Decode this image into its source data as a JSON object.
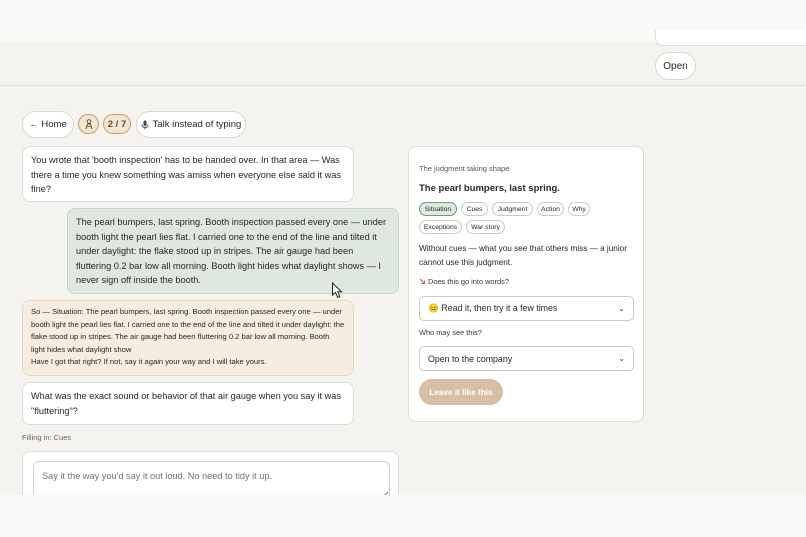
{
  "top": {
    "open_label": "Open"
  },
  "toolbar": {
    "home_label": "← Home",
    "person_badge_icon": "person-icon",
    "progress": "2 / 7",
    "talk_label": "Talk instead of typing",
    "talk_icon": "microphone-icon"
  },
  "chat": {
    "q1": "You wrote that 'booth inspection' has to be handed over. In that area — Was there a time you knew something was amiss when everyone else said it was fine?",
    "a1": "The pearl bumpers, last spring. Booth inspection passed every one — under booth light the pearl lies flat. I carried one to the end of the line and tilted it under daylight: the flake stood up in stripes. The air gauge had been fluttering 0.2 bar low all morning. Booth light hides what daylight shows — I never sign off inside the booth.",
    "summary": "So — Situation: The pearl bumpers, last spring. Booth inspection passed every one — under booth light the pearl lies flat. I carried one to the end of the line and tilted it under daylight: the flake stood up in stripes. The air gauge had been fluttering 0.2 bar low all morning. Booth light hides what daylight show",
    "summary_confirm": "Have I got that right? If not, say it again your way and I will take yours.",
    "q2": "What was the exact sound or behavior of that air gauge when you say it was \"fluttering\"?",
    "filling": "Filling in: Cues",
    "input_placeholder": "Say it the way you'd say it out loud. No need to tidy it up."
  },
  "panel": {
    "kicker": "The judgment taking shape",
    "title": "The pearl bumpers, last spring.",
    "chips": [
      "Situation",
      "Cues",
      "Judgment",
      "Action",
      "Why",
      "Exceptions",
      "War story"
    ],
    "active_chip": "Situation",
    "description": "Without cues — what you see that others miss — a junior cannot use this judgment.",
    "words_label": "Does this go into words?",
    "words_icon": "pointing-down-icon",
    "words_value": "😐 Read it, then try it a few times",
    "who_label": "Who may see this?",
    "who_value": "Open to the company",
    "leave_label": "Leave it like this"
  },
  "colors": {
    "background": "#f5f3ef",
    "user_bubble": "#dfe8df",
    "summary_bubble": "#f6ede1",
    "accent": "#c99e6c",
    "leave_button": "#d6bfa4"
  }
}
